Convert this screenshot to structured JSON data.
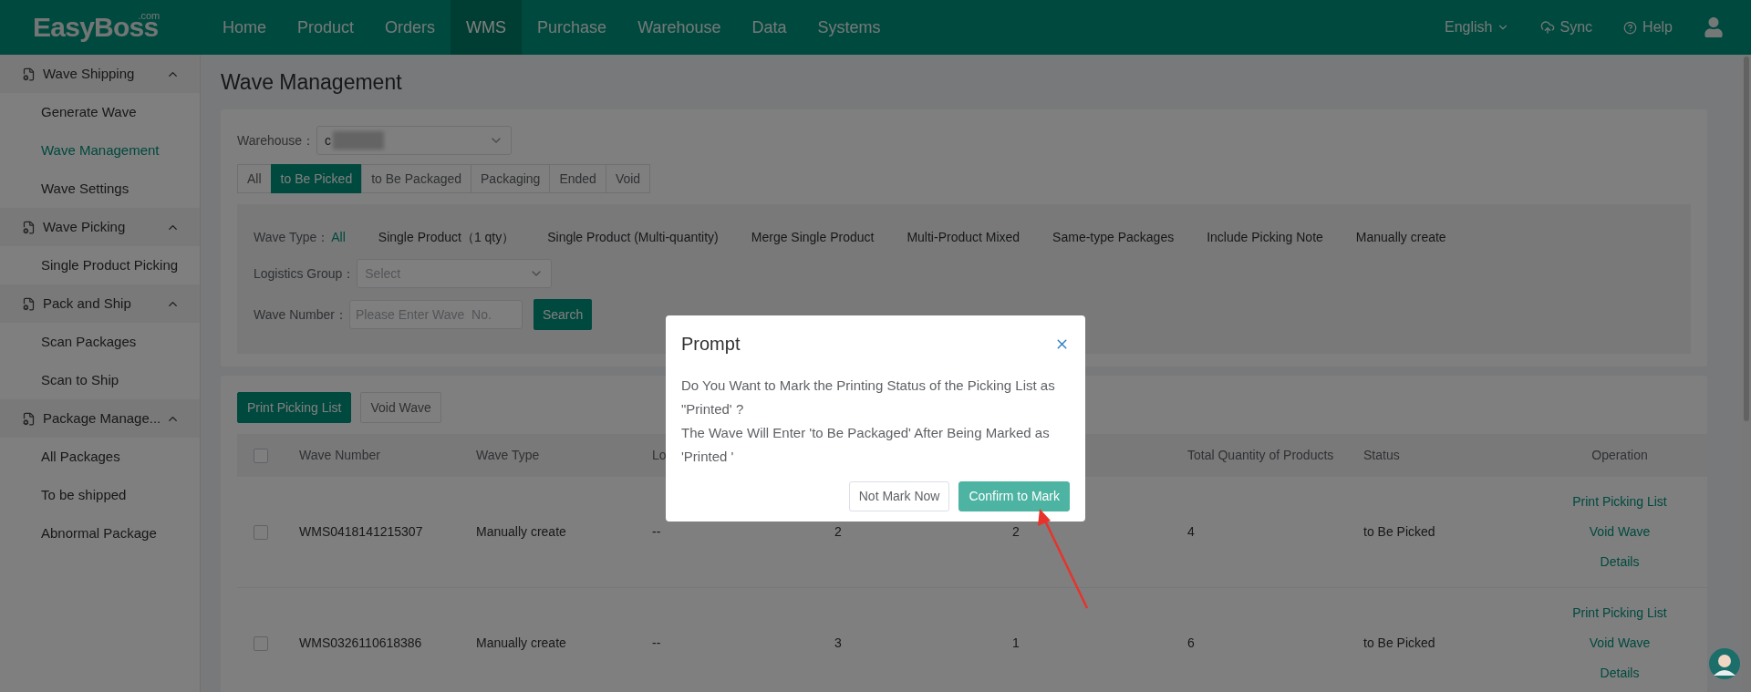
{
  "brand": {
    "name": "EasyBoss",
    "suffix": ".com"
  },
  "nav": {
    "items": [
      {
        "label": "Home",
        "selected": false
      },
      {
        "label": "Product",
        "selected": false
      },
      {
        "label": "Orders",
        "selected": false
      },
      {
        "label": "WMS",
        "selected": true
      },
      {
        "label": "Purchase",
        "selected": false
      },
      {
        "label": "Warehouse",
        "selected": false
      },
      {
        "label": "Data",
        "selected": false
      },
      {
        "label": "Systems",
        "selected": false
      }
    ]
  },
  "toolbar": {
    "language": "English",
    "sync": "Sync",
    "help": "Help"
  },
  "sidebar": {
    "groups": [
      {
        "label": "Wave Shipping",
        "expanded": true,
        "items": [
          {
            "label": "Generate Wave",
            "selected": false
          },
          {
            "label": "Wave Management",
            "selected": true
          },
          {
            "label": "Wave Settings",
            "selected": false
          }
        ]
      },
      {
        "label": "Wave Picking",
        "expanded": true,
        "items": [
          {
            "label": "Single Product Picking",
            "selected": false
          }
        ]
      },
      {
        "label": "Pack and Ship",
        "expanded": true,
        "items": [
          {
            "label": "Scan Packages",
            "selected": false
          },
          {
            "label": "Scan to Ship",
            "selected": false
          }
        ]
      },
      {
        "label": "Package Manage...",
        "expanded": true,
        "items": [
          {
            "label": "All Packages",
            "selected": false
          },
          {
            "label": "To be shipped",
            "selected": false
          },
          {
            "label": "Abnormal Package",
            "selected": false
          }
        ]
      }
    ]
  },
  "page": {
    "title": "Wave Management"
  },
  "filters": {
    "warehouse": {
      "label": "Warehouse：",
      "value": "c"
    },
    "status_tabs": [
      {
        "label": "All",
        "selected": false
      },
      {
        "label": "to Be Picked",
        "selected": true
      },
      {
        "label": "to Be Packaged",
        "selected": false
      },
      {
        "label": "Packaging",
        "selected": false
      },
      {
        "label": "Ended",
        "selected": false
      },
      {
        "label": "Void",
        "selected": false
      }
    ],
    "wave_type": {
      "label": "Wave Type：",
      "options": [
        {
          "label": "All",
          "selected": true
        },
        {
          "label": "Single Product（1 qty）",
          "selected": false
        },
        {
          "label": "Single Product (Multi-quantity)",
          "selected": false
        },
        {
          "label": "Merge Single Product",
          "selected": false
        },
        {
          "label": "Multi-Product Mixed",
          "selected": false
        },
        {
          "label": "Same-type Packages",
          "selected": false
        },
        {
          "label": "Include Picking Note",
          "selected": false
        },
        {
          "label": "Manually create",
          "selected": false
        }
      ]
    },
    "logistics_group": {
      "label": "Logistics Group：",
      "placeholder": "Select"
    },
    "wave_number": {
      "label": "Wave Number：",
      "placeholder": "Please Enter Wave  No."
    },
    "search_button": "Search"
  },
  "actions": [
    {
      "label": "Print Picking List",
      "kind": "primary"
    },
    {
      "label": "Void Wave",
      "kind": "secondary"
    }
  ],
  "table": {
    "select_all": {
      "checked": false
    },
    "columns": [
      "Wave Number",
      "Wave Type",
      "Lo",
      null,
      null,
      "Total Quantity of Products",
      "Status",
      "Operation"
    ],
    "rows": [
      {
        "checked": false,
        "cells": [
          "WMS0418141215307",
          "Manually create",
          "--",
          "2",
          "2",
          "4",
          "to Be Picked"
        ],
        "operations": [
          "Print Picking List",
          "Void Wave",
          "Details"
        ]
      },
      {
        "checked": false,
        "cells": [
          "WMS0326110618386",
          "Manually create",
          "--",
          "3",
          "1",
          "6",
          "to Be Picked"
        ],
        "operations": [
          "Print Picking List",
          "Void Wave",
          "Details"
        ]
      }
    ]
  },
  "dialog": {
    "title": "Prompt",
    "paragraphs": [
      "Do You Want to Mark the Printing Status of the Picking List as \"Printed' ?",
      "The Wave Will Enter 'to Be Packaged' After Being Marked as 'Printed '"
    ],
    "buttons": [
      {
        "label": "Not Mark Now",
        "kind": "secondary"
      },
      {
        "label": "Confirm to Mark",
        "kind": "primary"
      }
    ]
  }
}
